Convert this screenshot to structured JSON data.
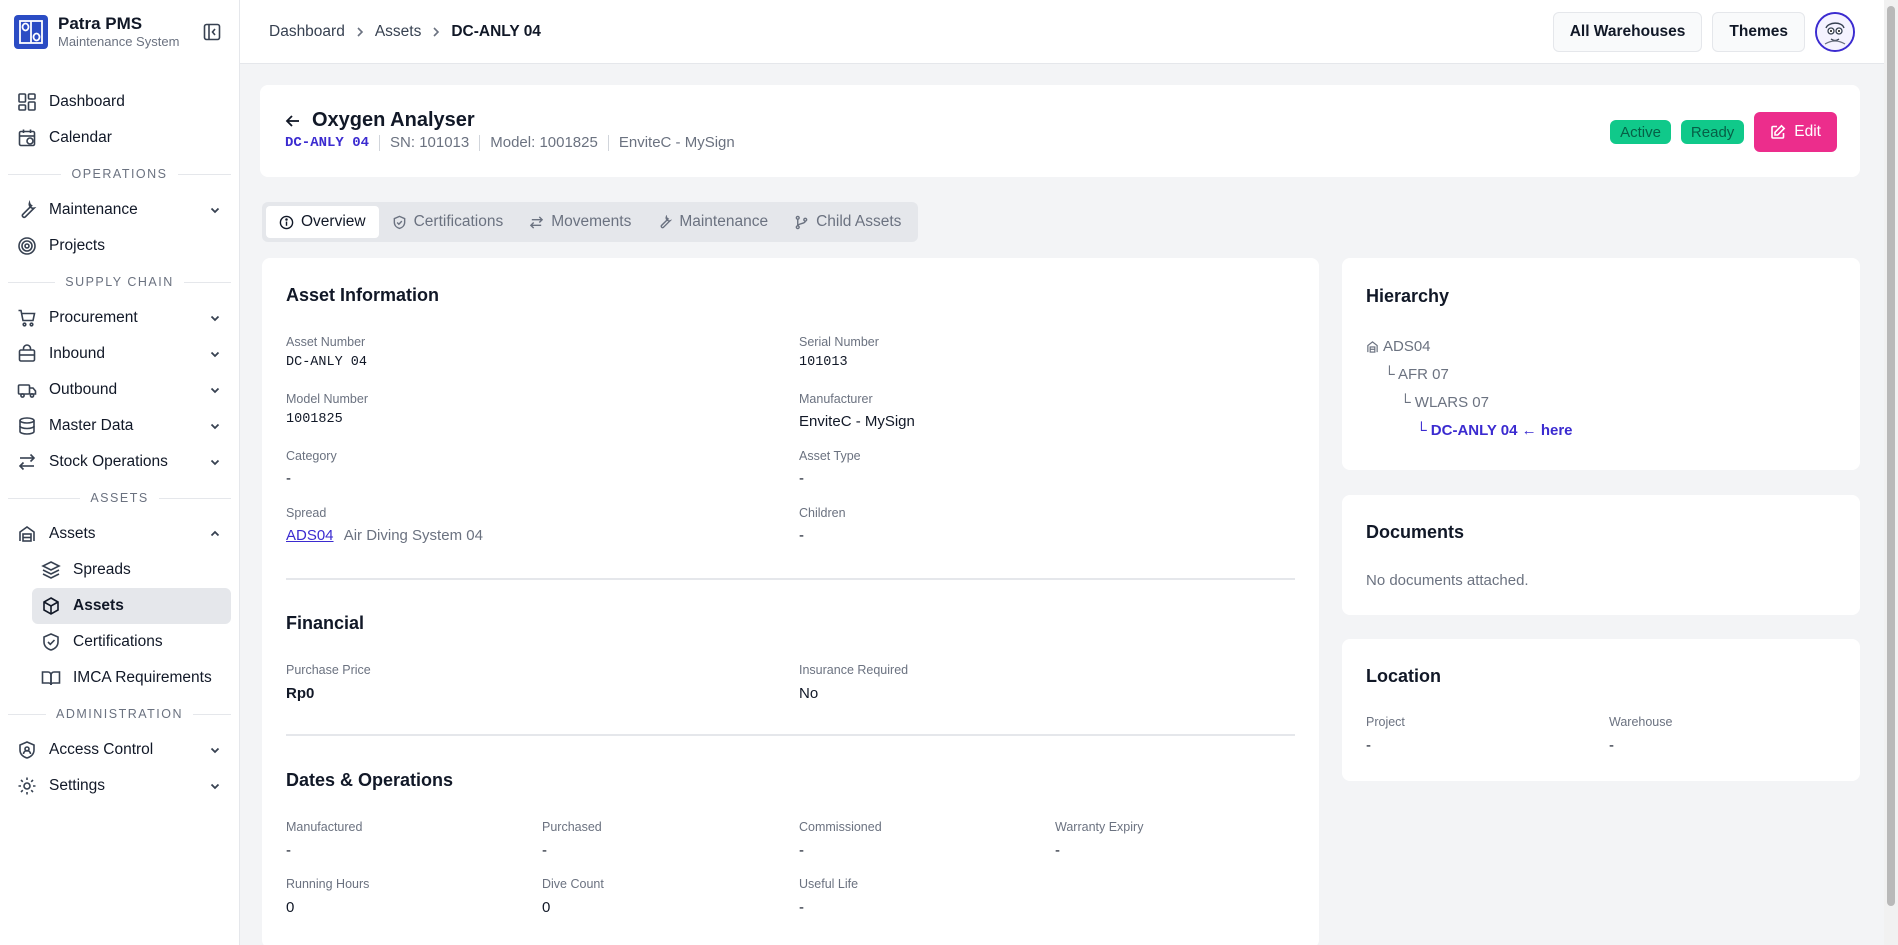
{
  "brand": {
    "title": "Patra PMS",
    "subtitle": "Maintenance System",
    "logo_icon": "patra-logo"
  },
  "sidebar": {
    "top_items": [
      {
        "label": "Dashboard",
        "icon": "dashboard-icon"
      },
      {
        "label": "Calendar",
        "icon": "calendar-icon"
      }
    ],
    "sections": {
      "operations": "OPERATIONS",
      "supply_chain": "SUPPLY CHAIN",
      "assets": "ASSETS",
      "administration": "ADMINISTRATION"
    },
    "operations_items": [
      {
        "label": "Maintenance",
        "icon": "wrench-icon",
        "expandable": true
      },
      {
        "label": "Projects",
        "icon": "target-icon",
        "expandable": false
      }
    ],
    "supply_items": [
      {
        "label": "Procurement",
        "icon": "cart-icon"
      },
      {
        "label": "Inbound",
        "icon": "inbox-icon"
      },
      {
        "label": "Outbound",
        "icon": "truck-icon"
      },
      {
        "label": "Master Data",
        "icon": "database-icon"
      },
      {
        "label": "Stock Operations",
        "icon": "arrows-icon"
      }
    ],
    "assets_group": {
      "label": "Assets",
      "icon": "assets-icon",
      "expanded": true
    },
    "assets_sub_items": [
      {
        "label": "Spreads",
        "icon": "layers-icon"
      },
      {
        "label": "Assets",
        "icon": "box-icon",
        "active": true
      },
      {
        "label": "Certifications",
        "icon": "shield-icon"
      },
      {
        "label": "IMCA Requirements",
        "icon": "book-icon"
      }
    ],
    "admin_items": [
      {
        "label": "Access Control",
        "icon": "lock-shield-icon"
      },
      {
        "label": "Settings",
        "icon": "gear-icon"
      }
    ]
  },
  "breadcrumb": [
    "Dashboard",
    "Assets",
    "DC-ANLY 04"
  ],
  "topbar": {
    "warehouse_button": "All Warehouses",
    "themes_button": "Themes"
  },
  "asset": {
    "title": "Oxygen Analyser",
    "asset_number": "DC-ANLY 04",
    "serial_display": "SN: 101013",
    "model_display": "Model: 1001825",
    "manufacturer_display": "EnviteC - MySign",
    "badges": [
      "Active",
      "Ready"
    ],
    "edit_label": "Edit"
  },
  "tabs": [
    {
      "label": "Overview",
      "icon": "info-icon",
      "active": true
    },
    {
      "label": "Certifications",
      "icon": "shield-check-icon"
    },
    {
      "label": "Movements",
      "icon": "swap-icon"
    },
    {
      "label": "Maintenance",
      "icon": "wrench-icon"
    },
    {
      "label": "Child Assets",
      "icon": "branch-icon"
    }
  ],
  "asset_info": {
    "title": "Asset Information",
    "asset_number_label": "Asset Number",
    "asset_number": "DC-ANLY 04",
    "serial_label": "Serial Number",
    "serial": "101013",
    "model_label": "Model Number",
    "model": "1001825",
    "manufacturer_label": "Manufacturer",
    "manufacturer": "EnviteC - MySign",
    "category_label": "Category",
    "category": "-",
    "asset_type_label": "Asset Type",
    "asset_type": "-",
    "spread_label": "Spread",
    "spread_code": "ADS04",
    "spread_name": "Air Diving System 04",
    "children_label": "Children",
    "children": "-"
  },
  "financial": {
    "title": "Financial",
    "price_label": "Purchase Price",
    "price": "Rp0",
    "insurance_label": "Insurance Required",
    "insurance": "No"
  },
  "dates": {
    "title": "Dates & Operations",
    "manufactured_label": "Manufactured",
    "manufactured": "-",
    "purchased_label": "Purchased",
    "purchased": "-",
    "commissioned_label": "Commissioned",
    "commissioned": "-",
    "warranty_label": "Warranty Expiry",
    "warranty": "-",
    "running_label": "Running Hours",
    "running": "0",
    "dive_label": "Dive Count",
    "dive": "0",
    "useful_label": "Useful Life",
    "useful": "-"
  },
  "hierarchy": {
    "title": "Hierarchy",
    "root": "ADS04",
    "level1": "└ AFR 07",
    "level2": "└ WLARS 07",
    "current": "└ DC-ANLY 04 ← here"
  },
  "documents": {
    "title": "Documents",
    "empty": "No documents attached."
  },
  "location": {
    "title": "Location",
    "project_label": "Project",
    "project": "-",
    "warehouse_label": "Warehouse",
    "warehouse": "-"
  },
  "colors": {
    "accent": "#3b2bd0",
    "edit": "#ec2d8c",
    "status_green": "#10c98a",
    "brand_blue": "#2b4cc4"
  }
}
